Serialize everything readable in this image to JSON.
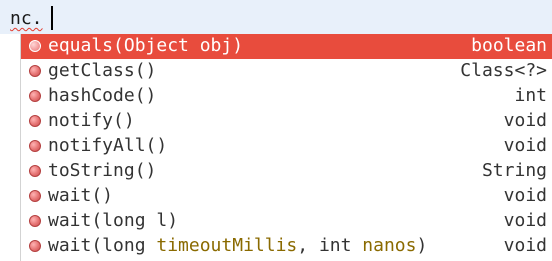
{
  "editor": {
    "text": "nc."
  },
  "completions": [
    {
      "name": "equals(Object obj)",
      "type": "boolean",
      "selected": true,
      "icon": "method-icon"
    },
    {
      "name": "getClass()",
      "type": "Class<?>",
      "selected": false,
      "icon": "method-icon"
    },
    {
      "name": "hashCode()",
      "type": "int",
      "selected": false,
      "icon": "method-icon"
    },
    {
      "name": "notify()",
      "type": "void",
      "selected": false,
      "icon": "method-icon"
    },
    {
      "name": "notifyAll()",
      "type": "void",
      "selected": false,
      "icon": "method-icon"
    },
    {
      "name": "toString()",
      "type": "String",
      "selected": false,
      "icon": "method-icon"
    },
    {
      "name": "wait()",
      "type": "void",
      "selected": false,
      "icon": "method-icon"
    },
    {
      "name": "wait(long l)",
      "type": "void",
      "selected": false,
      "icon": "method-icon"
    },
    {
      "name_parts": [
        {
          "text": "wait(long ",
          "param": false
        },
        {
          "text": "timeoutMillis",
          "param": true
        },
        {
          "text": ", int ",
          "param": false
        },
        {
          "text": "nanos",
          "param": true
        },
        {
          "text": ")",
          "param": false
        }
      ],
      "type": "void",
      "selected": false,
      "icon": "method-icon"
    }
  ],
  "colors": {
    "selection": "#e84c3d",
    "parameter_hint": "#8a6a00",
    "editor_line": "#e8f0fa"
  }
}
